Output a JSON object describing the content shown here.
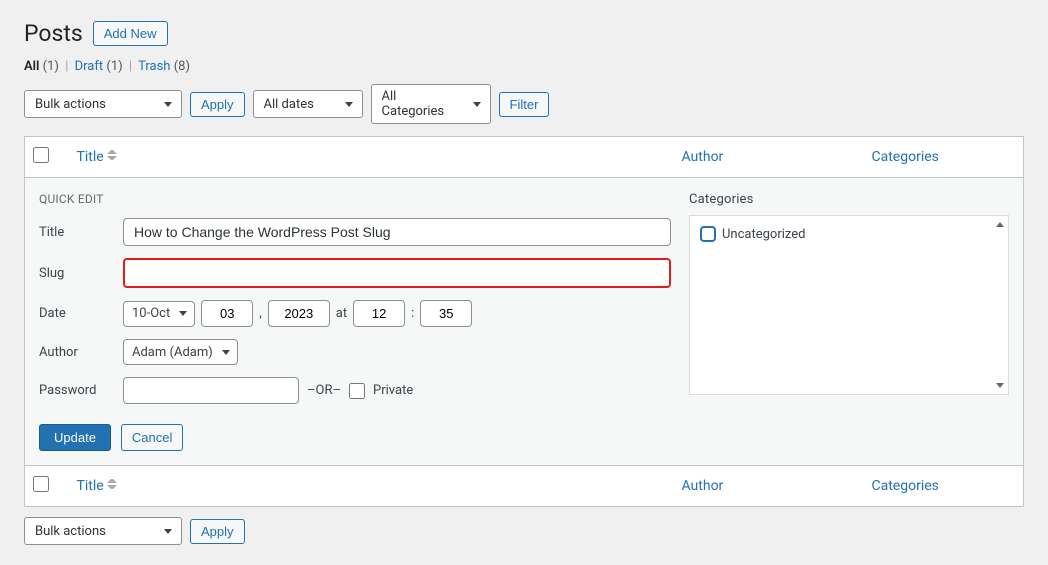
{
  "header": {
    "title": "Posts",
    "add_new": "Add New"
  },
  "views": {
    "all": {
      "label": "All",
      "count": "(1)"
    },
    "draft": {
      "label": "Draft",
      "count": "(1)"
    },
    "trash": {
      "label": "Trash",
      "count": "(8)"
    }
  },
  "filters": {
    "bulk": "Bulk actions",
    "apply": "Apply",
    "dates": "All dates",
    "categories": "All Categories",
    "filter": "Filter"
  },
  "columns": {
    "title": "Title",
    "author": "Author",
    "categories": "Categories"
  },
  "quick_edit": {
    "heading": "QUICK EDIT",
    "labels": {
      "title": "Title",
      "slug": "Slug",
      "date": "Date",
      "author": "Author",
      "password": "Password"
    },
    "title_value": "How to Change the WordPress Post Slug",
    "slug_value": "",
    "month": "10-Oct",
    "day": "03",
    "year": "2023",
    "at": "at",
    "hour": "12",
    "sep": ":",
    "minute": "35",
    "author_value": "Adam (Adam)",
    "or": "–OR–",
    "private": "Private",
    "update": "Update",
    "cancel": "Cancel"
  },
  "categories_panel": {
    "heading": "Categories",
    "items": [
      {
        "label": "Uncategorized",
        "checked": false
      }
    ]
  },
  "bottom": {
    "bulk": "Bulk actions",
    "apply": "Apply"
  }
}
